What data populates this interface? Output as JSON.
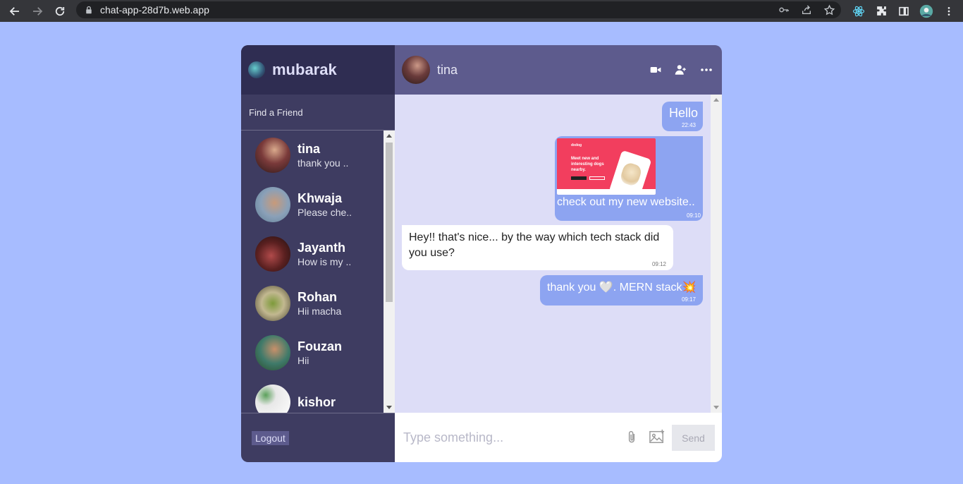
{
  "browser": {
    "url": "chat-app-28d7b.web.app",
    "icons": [
      "back-icon",
      "forward-icon",
      "reload-icon",
      "lock-icon",
      "key-icon",
      "share-icon",
      "star-icon",
      "react-devtools-icon",
      "extensions-icon",
      "sidepanel-icon",
      "profile-icon",
      "menu-icon"
    ]
  },
  "sidebar": {
    "user_name": "mubarak",
    "search_placeholder": "Find a Friend",
    "chats": [
      {
        "name": "tina",
        "last": "thank you .."
      },
      {
        "name": "Khwaja",
        "last": "Please che.."
      },
      {
        "name": "Jayanth",
        "last": "How is my .."
      },
      {
        "name": "Rohan",
        "last": "Hii macha"
      },
      {
        "name": "Fouzan",
        "last": "Hii"
      },
      {
        "name": "kishor",
        "last": ""
      }
    ],
    "logout_label": "Logout"
  },
  "chat": {
    "contact_name": "tina",
    "messages": [
      {
        "text": "Hello",
        "time": "22:43",
        "owner": true
      },
      {
        "text": "check out my new website..",
        "time": "09:10",
        "owner": true,
        "image": {
          "brand": "dxdog",
          "headline": "Meet new and interesting dogs nearby."
        }
      },
      {
        "text": "Hey!! that's nice... by the way which tech stack did you use?",
        "time": "09:12",
        "owner": false
      },
      {
        "text": "thank you 🤍. MERN stack💥",
        "time": "09:17",
        "owner": true
      }
    ],
    "input_placeholder": "Type something...",
    "send_label": "Send"
  },
  "colors": {
    "page_bg": "#a7bcff",
    "sidebar_bg": "#3e3c61",
    "sidebar_nav_bg": "#2f2d52",
    "header_bg": "#5d5b8d",
    "messages_bg": "#ddddf7",
    "owner_bubble": "#8da4f1"
  }
}
